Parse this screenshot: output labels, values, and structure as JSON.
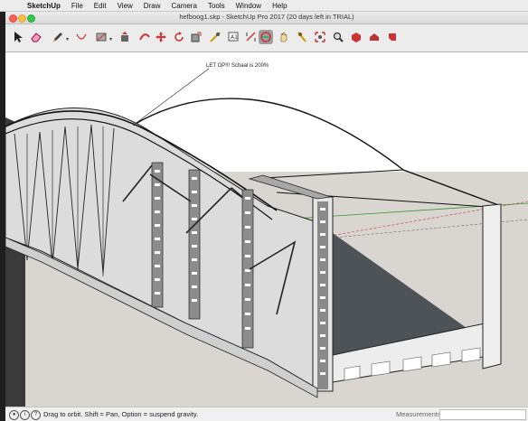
{
  "menubar": {
    "app_name": "SketchUp",
    "items": [
      "File",
      "Edit",
      "View",
      "Draw",
      "Camera",
      "Tools",
      "Window",
      "Help"
    ]
  },
  "window": {
    "title": "hefboog1.skp - SketchUp Pro 2017 (20 days left in TRIAL)"
  },
  "toolbar": {
    "tools": [
      "select-arrow-icon",
      "eraser-icon",
      "pencil-icon",
      "rectangle-icon",
      "paint-bucket-icon",
      "push-pull-icon",
      "move-icon",
      "rotate-icon",
      "scale-icon",
      "tape-measure-icon",
      "text-icon",
      "orbit-icon",
      "pan-icon",
      "zoom-icon",
      "zoom-extents-icon",
      "3d-warehouse-icon",
      "extension-warehouse-icon",
      "layout-icon"
    ],
    "active_tool": "orbit-icon"
  },
  "viewport": {
    "annotation": "LET OP!!! Schaal is 200%",
    "sky_color": "#ffffff",
    "ground_color": "#d9d6d2"
  },
  "statusbar": {
    "message": "Drag to orbit. Shift = Pan, Option = suspend gravity.",
    "measurements_label": "Measurements",
    "measurements_value": ""
  }
}
